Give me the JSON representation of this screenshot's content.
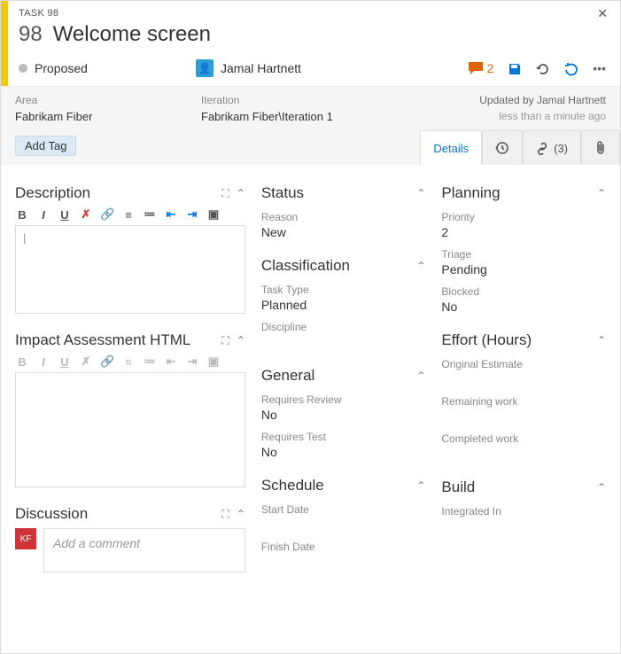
{
  "header": {
    "type_label": "TASK 98",
    "id": "98",
    "title": "Welcome screen",
    "state": "Proposed",
    "assignee": "Jamal Hartnett",
    "comment_count": "2"
  },
  "info": {
    "area_label": "Area",
    "area_value": "Fabrikam Fiber",
    "iteration_label": "Iteration",
    "iteration_value": "Fabrikam Fiber\\Iteration 1",
    "updated_by": "Updated by Jamal Hartnett",
    "updated_ago": "less than a minute ago",
    "add_tag": "Add Tag"
  },
  "tabs": {
    "details": "Details",
    "links_count": "(3)"
  },
  "col1": {
    "description": "Description",
    "editor_placeholder": "|",
    "impact": "Impact Assessment HTML",
    "discussion": "Discussion",
    "comment_placeholder": "Add a comment"
  },
  "status": {
    "title": "Status",
    "reason_label": "Reason",
    "reason_value": "New",
    "classification_title": "Classification",
    "task_type_label": "Task Type",
    "task_type_value": "Planned",
    "discipline_label": "Discipline",
    "general_title": "General",
    "req_review_label": "Requires Review",
    "req_review_value": "No",
    "req_test_label": "Requires Test",
    "req_test_value": "No",
    "schedule_title": "Schedule",
    "start_date_label": "Start Date",
    "finish_date_label": "Finish Date"
  },
  "planning": {
    "title": "Planning",
    "priority_label": "Priority",
    "priority_value": "2",
    "triage_label": "Triage",
    "triage_value": "Pending",
    "blocked_label": "Blocked",
    "blocked_value": "No",
    "effort_title": "Effort (Hours)",
    "orig_est_label": "Original Estimate",
    "remaining_label": "Remaining work",
    "completed_label": "Completed work",
    "build_title": "Build",
    "integrated_label": "Integrated In"
  }
}
